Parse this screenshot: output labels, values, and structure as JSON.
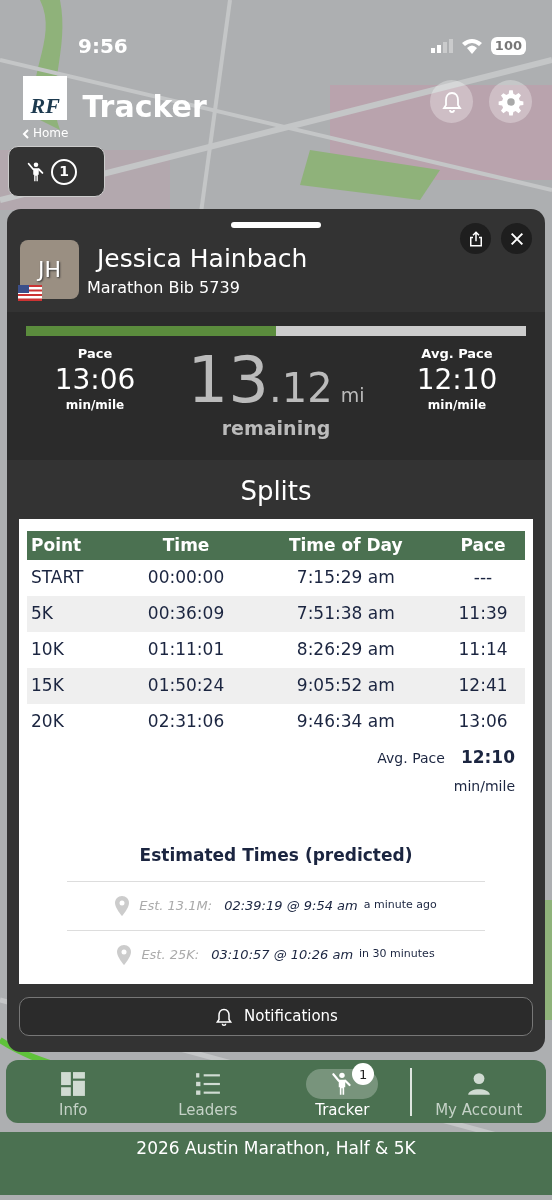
{
  "status_bar": {
    "time": "9:56",
    "battery": "100"
  },
  "header": {
    "logo_text": "RF",
    "title": "Tracker",
    "back_link": "Home"
  },
  "tracked_button": {
    "count": "1"
  },
  "runner": {
    "initials": "JH",
    "name": "Jessica Hainbach",
    "bib": "Marathon Bib 5739",
    "level": 0.5
  },
  "stats": {
    "pace_label": "Pace",
    "pace": "13:06",
    "pace_unit": "min/mile",
    "distance_whole": "13",
    "distance_fraction": ".12",
    "distance_unit": "mi",
    "distance_caption": "remaining",
    "avg_label": "Avg. Pace",
    "avg": "12:10",
    "avg_unit": "min/mile"
  },
  "splits": {
    "title": "Splits",
    "columns": [
      "Point",
      "Time",
      "Time of Day",
      "Pace"
    ],
    "rows": [
      [
        "START",
        "00:00:00",
        "7:15:29 am",
        "---"
      ],
      [
        "5K",
        "00:36:09",
        "7:51:38 am",
        "11:39"
      ],
      [
        "10K",
        "01:11:01",
        "8:26:29 am",
        "11:14"
      ],
      [
        "15K",
        "01:50:24",
        "9:05:52 am",
        "12:41"
      ],
      [
        "20K",
        "02:31:06",
        "9:46:34 am",
        "13:06"
      ]
    ],
    "avg_label": "Avg. Pace",
    "avg_value": "12:10",
    "avg_unit": "min/mile"
  },
  "estimates": {
    "title": "Estimated Times (predicted)",
    "rows": [
      {
        "label": "Est. 13.1M:",
        "time": "02:39:19 @ 9:54 am",
        "relative": "a minute ago"
      },
      {
        "label": "Est. 25K:",
        "time": "03:10:57 @ 10:26 am",
        "relative": "in 30 minutes"
      }
    ]
  },
  "notifications_button": "Notifications",
  "tabs": [
    {
      "label": "Info",
      "kind": "grid",
      "selected": false
    },
    {
      "label": "Leaders",
      "kind": "list",
      "selected": false
    },
    {
      "label": "Tracker",
      "kind": "walker",
      "selected": true,
      "badge": "1"
    },
    {
      "label": "My Account",
      "kind": "user",
      "selected": false
    }
  ],
  "footer": "2026 Austin Marathon, Half & 5K"
}
